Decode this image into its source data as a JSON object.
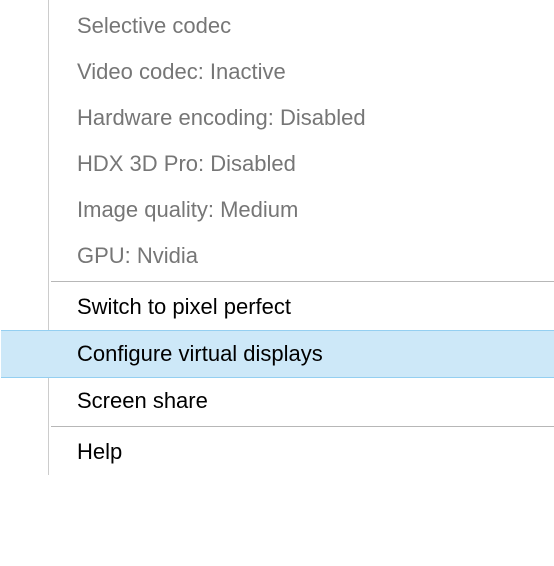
{
  "menu": {
    "info_items": [
      {
        "name": "info-selective-codec",
        "label": "Selective codec"
      },
      {
        "name": "info-video-codec",
        "label": "Video codec: Inactive"
      },
      {
        "name": "info-hardware-encoding",
        "label": "Hardware encoding: Disabled"
      },
      {
        "name": "info-hdx-3d-pro",
        "label": "HDX 3D Pro: Disabled"
      },
      {
        "name": "info-image-quality",
        "label": "Image quality: Medium"
      },
      {
        "name": "info-gpu",
        "label": "GPU: Nvidia"
      }
    ],
    "action_items": [
      {
        "name": "action-switch-pixel-perfect",
        "label": "Switch to pixel perfect",
        "highlighted": false,
        "submenu": false
      },
      {
        "name": "action-configure-virtual-displays",
        "label": "Configure virtual displays",
        "highlighted": true,
        "submenu": false
      },
      {
        "name": "action-screen-share",
        "label": "Screen share",
        "highlighted": false,
        "submenu": true
      }
    ],
    "help_item": {
      "name": "action-help",
      "label": "Help"
    }
  }
}
